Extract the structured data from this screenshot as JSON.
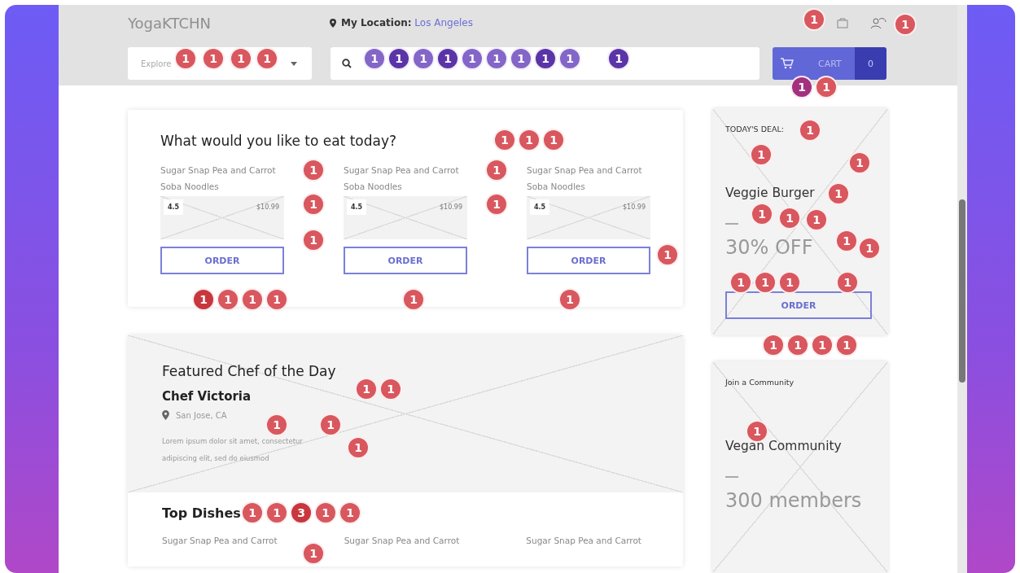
{
  "header": {
    "logo": "YogaKTCHN",
    "location_label": "My Location:",
    "location": "Los Angeles",
    "explore": "Explore",
    "cart": {
      "label": "CART",
      "count": "0"
    }
  },
  "suggestions": {
    "title": "What would you like to eat today?",
    "dishes": [
      {
        "name": "Sugar Snap Pea and Carrot Soba Noodles",
        "rating": "4.5",
        "price": "$10.99",
        "button": "ORDER"
      },
      {
        "name": "Sugar Snap Pea and Carrot Soba Noodles",
        "rating": "4.5",
        "price": "$10.99",
        "button": "ORDER"
      },
      {
        "name": "Sugar Snap Pea and Carrot Soba Noodles",
        "rating": "4.5",
        "price": "$10.99",
        "button": "ORDER"
      }
    ]
  },
  "featured_chef": {
    "title": "Featured Chef of the Day",
    "name": "Chef Victoria",
    "location": "San Jose, CA",
    "bio": "Lorem ipsum dolor sit amet, consectetur adipiscing elit, sed do eiusmod"
  },
  "top_dishes": {
    "title": "Top Dishes",
    "dishes": [
      "Sugar Snap Pea and Carrot",
      "Sugar Snap Pea and Carrot",
      "Sugar Snap Pea and Carrot"
    ]
  },
  "deal": {
    "label": "TODAY'S DEAL:",
    "name": "Veggie Burger",
    "offer": "30% OFF",
    "button": "ORDER"
  },
  "community": {
    "label": "Join a Community",
    "name": "Vegan Community",
    "members": "300 members"
  },
  "click_markers": [
    {
      "count": "1",
      "color": "#d9575e"
    },
    {
      "count": "1",
      "color": "#d9575e"
    },
    {
      "count": "1",
      "color": "#d9575e"
    },
    {
      "count": "1",
      "color": "#d9575e"
    },
    {
      "count": "1",
      "color": "#d9575e"
    },
    {
      "count": "1",
      "color": "#d9575e"
    },
    {
      "count": "1",
      "color": "#8466c8"
    },
    {
      "count": "1",
      "color": "#5b34a8"
    },
    {
      "count": "1",
      "color": "#8466c8"
    },
    {
      "count": "1",
      "color": "#5b34a8"
    },
    {
      "count": "1",
      "color": "#8466c8"
    },
    {
      "count": "1",
      "color": "#8466c8"
    },
    {
      "count": "1",
      "color": "#8466c8"
    },
    {
      "count": "1",
      "color": "#5b34a8"
    },
    {
      "count": "1",
      "color": "#8466c8"
    },
    {
      "count": "1",
      "color": "#5b34a8"
    },
    {
      "count": "1",
      "color": "#a3307e"
    },
    {
      "count": "1",
      "color": "#d9575e"
    },
    {
      "count": "1",
      "color": "#d9575e"
    },
    {
      "count": "1",
      "color": "#d9575e"
    },
    {
      "count": "1",
      "color": "#d9575e"
    },
    {
      "count": "1",
      "color": "#d9575e"
    },
    {
      "count": "1",
      "color": "#d9575e"
    },
    {
      "count": "1",
      "color": "#d9575e"
    },
    {
      "count": "1",
      "color": "#d9575e"
    },
    {
      "count": "1",
      "color": "#d9575e"
    },
    {
      "count": "1",
      "color": "#d9575e"
    },
    {
      "count": "1",
      "color": "#d9575e"
    },
    {
      "count": "1",
      "color": "#d9575e"
    },
    {
      "count": "1",
      "color": "#d9575e"
    },
    {
      "count": "1",
      "color": "#d9575e"
    },
    {
      "count": "1",
      "color": "#d9575e"
    },
    {
      "count": "1",
      "color": "#d9575e"
    },
    {
      "count": "1",
      "color": "#d9575e"
    },
    {
      "count": "1",
      "color": "#d9575e"
    },
    {
      "count": "1",
      "color": "#d9575e"
    },
    {
      "count": "1",
      "color": "#d9575e"
    },
    {
      "count": "1",
      "color": "#d9575e"
    },
    {
      "count": "1",
      "color": "#d9575e"
    },
    {
      "count": "1",
      "color": "#d9575e"
    },
    {
      "count": "1",
      "color": "#c8363e"
    },
    {
      "count": "1",
      "color": "#d9575e"
    },
    {
      "count": "1",
      "color": "#d9575e"
    },
    {
      "count": "1",
      "color": "#d9575e"
    },
    {
      "count": "1",
      "color": "#d9575e"
    },
    {
      "count": "1",
      "color": "#d9575e"
    },
    {
      "count": "1",
      "color": "#d9575e"
    },
    {
      "count": "1",
      "color": "#d9575e"
    },
    {
      "count": "1",
      "color": "#d9575e"
    },
    {
      "count": "1",
      "color": "#d9575e"
    },
    {
      "count": "1",
      "color": "#d9575e"
    },
    {
      "count": "1",
      "color": "#d9575e"
    },
    {
      "count": "1",
      "color": "#d9575e"
    },
    {
      "count": "1",
      "color": "#d9575e"
    },
    {
      "count": "1",
      "color": "#d9575e"
    },
    {
      "count": "1",
      "color": "#d9575e"
    },
    {
      "count": "1",
      "color": "#d9575e"
    },
    {
      "count": "1",
      "color": "#d9575e"
    },
    {
      "count": "3",
      "color": "#c8363e"
    },
    {
      "count": "1",
      "color": "#d9575e"
    },
    {
      "count": "1",
      "color": "#d9575e"
    },
    {
      "count": "1",
      "color": "#d9575e"
    }
  ]
}
